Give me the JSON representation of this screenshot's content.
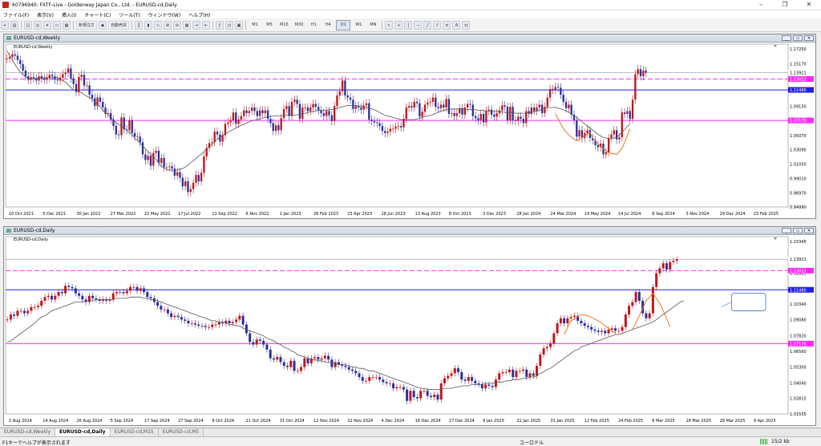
{
  "titlebar": {
    "title": "60796940: FXTF-Live - Goldenway Japan Co., Ltd. - EURUSD-cd,Daily"
  },
  "menu": [
    "ファイル(F)",
    "表示(V)",
    "挿入(I)",
    "チャート(C)",
    "ツール(T)",
    "ウィンドウ(W)",
    "ヘルプ(H)"
  ],
  "toolbar": {
    "new_order": "新規注文",
    "auto_trade": "自動売買",
    "periods": [
      "M1",
      "M5",
      "M15",
      "M30",
      "H1",
      "H4",
      "D1",
      "W1",
      "MN"
    ],
    "active_period": "D1"
  },
  "colors": {
    "bull": "#c0151b",
    "bear": "#2b2f9c",
    "pink": "#ff2aff",
    "blue": "#2020e0",
    "ma": "#555555",
    "orange": "#e87a1e",
    "price_bg": "#2020e0"
  },
  "weekly": {
    "title": "EURUSD-cd,Weekly",
    "y_labels": [
      "1.17250",
      "1.15170",
      "1.13921",
      "1.13011",
      "1.11480",
      "1.09150",
      "1.07175",
      "1.05070",
      "1.03090",
      "1.01050",
      "0.99010",
      "0.96970",
      "0.94990"
    ],
    "x_labels": [
      "10 Oct 2021",
      "5 Dec 2021",
      "30 Jan 2022",
      "27 Mar 2022",
      "22 May 2022",
      "17 Jul 2022",
      "11 Sep 2022",
      "6 Nov 2022",
      "1 Jan 2023",
      "26 Feb 2023",
      "23 Apr 2023",
      "18 Jun 2023",
      "13 Aug 2023",
      "8 Oct 2023",
      "3 Dec 2023",
      "28 Jan 2024",
      "24 Mar 2024",
      "19 May 2024",
      "14 Jul 2024",
      "8 Sep 2024",
      "3 Nov 2024",
      "29 Dec 2024",
      "23 Feb 2025"
    ],
    "ymin": 0.9499,
    "ymax": 1.1725,
    "price": 1.13921,
    "pink": 1.13011,
    "blue": 1.1148,
    "mag": 1.07175,
    "price_label": "1.13921",
    "pink_label": "1.13011",
    "blue_label": "1.11480",
    "mag_label": "1.07175",
    "closes": [
      1.159,
      1.161,
      1.165,
      1.163,
      1.157,
      1.151,
      1.142,
      1.134,
      1.129,
      1.133,
      1.131,
      1.128,
      1.134,
      1.131,
      1.129,
      1.132,
      1.136,
      1.134,
      1.129,
      1.128,
      1.132,
      1.137,
      1.139,
      1.145,
      1.131,
      1.123,
      1.112,
      1.133,
      1.136,
      1.121,
      1.121,
      1.108,
      1.103,
      1.092,
      1.104,
      1.098,
      1.09,
      1.081,
      1.082,
      1.073,
      1.064,
      1.052,
      1.051,
      1.076,
      1.059,
      1.058,
      1.072,
      1.054,
      1.049,
      1.049,
      1.041,
      1.024,
      1.016,
      1.022,
      1.008,
      1.026,
      1.029,
      1.012,
      1.019,
      1.006,
      1.006,
      1.007,
      1.004,
      0.994,
      0.999,
      0.991,
      0.979,
      0.986,
      0.971,
      0.975,
      0.984,
      0.995,
      0.986,
      0.998,
      1.021,
      1.033,
      1.04,
      1.041,
      1.056,
      1.052,
      1.042,
      1.051,
      1.067,
      1.069,
      1.072,
      1.083,
      1.067,
      1.073,
      1.078,
      1.086,
      1.082,
      1.085,
      1.09,
      1.085,
      1.078,
      1.086,
      1.082,
      1.086,
      1.074,
      1.068,
      1.057,
      1.065,
      1.058,
      1.075,
      1.088,
      1.092,
      1.078,
      1.098,
      1.101,
      1.095,
      1.074,
      1.09,
      1.09,
      1.085,
      1.09,
      1.095,
      1.091,
      1.086,
      1.082,
      1.078,
      1.085,
      1.079,
      1.071,
      1.092,
      1.107,
      1.113,
      1.128,
      1.107,
      1.104,
      1.101,
      1.088,
      1.092,
      1.09,
      1.087,
      1.093,
      1.096,
      1.073,
      1.071,
      1.069,
      1.068,
      1.064,
      1.057,
      1.054,
      1.056,
      1.06,
      1.06,
      1.063,
      1.064,
      1.062,
      1.074,
      1.09,
      1.092,
      1.09,
      1.098,
      1.096,
      1.077,
      1.084,
      1.094,
      1.097,
      1.098,
      1.104,
      1.091,
      1.089,
      1.094,
      1.09,
      1.102,
      1.081,
      1.082,
      1.078,
      1.082,
      1.089,
      1.08,
      1.09,
      1.095,
      1.094,
      1.078,
      1.075,
      1.072,
      1.081,
      1.069,
      1.085,
      1.087,
      1.08,
      1.077,
      1.082,
      1.086,
      1.093,
      1.091,
      1.072,
      1.091,
      1.072,
      1.071,
      1.077,
      1.074,
      1.068,
      1.085,
      1.081,
      1.09,
      1.085,
      1.09,
      1.094,
      1.082,
      1.091,
      1.104,
      1.116,
      1.115,
      1.119,
      1.118,
      1.108,
      1.098,
      1.089,
      1.094,
      1.08,
      1.072,
      1.049,
      1.058,
      1.047,
      1.054,
      1.058,
      1.047,
      1.044,
      1.037,
      1.034,
      1.039,
      1.024,
      1.027,
      1.047,
      1.052,
      1.058,
      1.045,
      1.048,
      1.083,
      1.081,
      1.085,
      1.074,
      1.101,
      1.137,
      1.144,
      1.134,
      1.142,
      1.139
    ],
    "ma": [
      1.17,
      1.163,
      1.157,
      1.151,
      1.145,
      1.14,
      1.136,
      1.133,
      1.131,
      1.13,
      1.13,
      1.131,
      1.131,
      1.131,
      1.132,
      1.132,
      1.132,
      1.132,
      1.132,
      1.132,
      1.13,
      1.128,
      1.126,
      1.122,
      1.118,
      1.115,
      1.113,
      1.112,
      1.111,
      1.108,
      1.106,
      1.104,
      1.102,
      1.098,
      1.094,
      1.091,
      1.086,
      1.083,
      1.08,
      1.076,
      1.072,
      1.069,
      1.066,
      1.064,
      1.061,
      1.058,
      1.055,
      1.052,
      1.047,
      1.044,
      1.04,
      1.036,
      1.032,
      1.028,
      1.024,
      1.021,
      1.017,
      1.012,
      1.007,
      1.005,
      1.003,
      1.002,
      1.002,
      1.001,
      1.002,
      1.003,
      1.004,
      1.006,
      1.009,
      1.012,
      1.015,
      1.018,
      1.022,
      1.024,
      1.028,
      1.032,
      1.035,
      1.038,
      1.042,
      1.045,
      1.048,
      1.051,
      1.053,
      1.055,
      1.057,
      1.059,
      1.061,
      1.063,
      1.065,
      1.066,
      1.068,
      1.07,
      1.071,
      1.072,
      1.073,
      1.074,
      1.075,
      1.076,
      1.077,
      1.077,
      1.078,
      1.078,
      1.078,
      1.078,
      1.079,
      1.079,
      1.079,
      1.079,
      1.079,
      1.08,
      1.08,
      1.081,
      1.082,
      1.083,
      1.084,
      1.084,
      1.085,
      1.086,
      1.086,
      1.086,
      1.086,
      1.087,
      1.087,
      1.088,
      1.089,
      1.09,
      1.091,
      1.092,
      1.093,
      1.093,
      1.093,
      1.093,
      1.092,
      1.092,
      1.091,
      1.09,
      1.089,
      1.088,
      1.087,
      1.085,
      1.083,
      1.081,
      1.079,
      1.078,
      1.077,
      1.076,
      1.075,
      1.074,
      1.073,
      1.073,
      1.073,
      1.073,
      1.073,
      1.073,
      1.074,
      1.075,
      1.076,
      1.077,
      1.078,
      1.079,
      1.08,
      1.082,
      1.083,
      1.085,
      1.086,
      1.087,
      1.087,
      1.088,
      1.088,
      1.088,
      1.088,
      1.088,
      1.088,
      1.087,
      1.087,
      1.087,
      1.087,
      1.086,
      1.086,
      1.086,
      1.085,
      1.085,
      1.085,
      1.085,
      1.085,
      1.084,
      1.084,
      1.083,
      1.083,
      1.083,
      1.083,
      1.082,
      1.082,
      1.082,
      1.082,
      1.082,
      1.083,
      1.083,
      1.084,
      1.085,
      1.086,
      1.088,
      1.089,
      1.09,
      1.09,
      1.09,
      1.09,
      1.089,
      1.088,
      1.087,
      1.085,
      1.083,
      1.081,
      1.078,
      1.076,
      1.073,
      1.07,
      1.067,
      1.064,
      1.061,
      1.058,
      1.055,
      1.052,
      1.05,
      1.048,
      1.047,
      1.046,
      1.046,
      1.047,
      1.048,
      1.051,
      1.055,
      1.059,
      1.063,
      1.067
    ]
  },
  "daily": {
    "title": "EURUSD-cd,Daily",
    "y_labels": [
      "1.15345",
      "1.13921",
      "1.12825",
      "1.13011",
      "1.11480",
      "1.10340",
      "1.09080",
      "1.07820",
      "1.07175",
      "1.06560",
      "1.05300",
      "1.04040",
      "1.02815",
      "1.01555"
    ],
    "x_labels": [
      "2 Aug 2024",
      "14 Aug 2024",
      "26 Aug 2024",
      "5 Sep 2024",
      "17 Sep 2024",
      "27 Sep 2024",
      "9 Oct 2024",
      "21 Oct 2024",
      "31 Oct 2024",
      "12 Nov 2024",
      "22 Nov 2024",
      "4 Dec 2024",
      "16 Dec 2024",
      "27 Dec 2024",
      "9 Jan 2025",
      "21 Jan 2025",
      "31 Jan 2025",
      "12 Feb 2025",
      "24 Feb 2025",
      "6 Mar 2025",
      "18 Mar 2025",
      "28 Mar 2025",
      "9 Apr 2025"
    ],
    "ymin": 1.01555,
    "ymax": 1.15345,
    "price": 1.13921,
    "pink": 1.13011,
    "blue": 1.1148,
    "mag": 1.07175,
    "price_label": "1.13921",
    "pink_label": "1.13011",
    "blue_label": "1.11480",
    "mag_label": "1.07175",
    "closes": [
      1.091,
      1.095,
      1.094,
      1.098,
      1.098,
      1.096,
      1.098,
      1.101,
      1.101,
      1.102,
      1.106,
      1.109,
      1.11,
      1.107,
      1.11,
      1.113,
      1.112,
      1.118,
      1.117,
      1.116,
      1.112,
      1.11,
      1.107,
      1.105,
      1.11,
      1.108,
      1.107,
      1.106,
      1.107,
      1.106,
      1.107,
      1.112,
      1.113,
      1.113,
      1.112,
      1.114,
      1.117,
      1.117,
      1.114,
      1.116,
      1.113,
      1.109,
      1.108,
      1.105,
      1.102,
      1.099,
      1.099,
      1.096,
      1.093,
      1.094,
      1.093,
      1.091,
      1.09,
      1.088,
      1.088,
      1.087,
      1.086,
      1.086,
      1.085,
      1.085,
      1.087,
      1.087,
      1.089,
      1.088,
      1.09,
      1.088,
      1.089,
      1.091,
      1.094,
      1.087,
      1.08,
      1.073,
      1.071,
      1.075,
      1.074,
      1.071,
      1.067,
      1.06,
      1.059,
      1.061,
      1.057,
      1.054,
      1.053,
      1.058,
      1.05,
      1.05,
      1.053,
      1.06,
      1.056,
      1.06,
      1.061,
      1.059,
      1.06,
      1.062,
      1.059,
      1.053,
      1.057,
      1.055,
      1.054,
      1.053,
      1.051,
      1.05,
      1.048,
      1.045,
      1.042,
      1.042,
      1.045,
      1.045,
      1.045,
      1.043,
      1.041,
      1.04,
      1.04,
      1.036,
      1.037,
      1.037,
      1.035,
      1.026,
      1.034,
      1.029,
      1.028,
      1.034,
      1.034,
      1.03,
      1.029,
      1.031,
      1.027,
      1.04,
      1.044,
      1.046,
      1.048,
      1.052,
      1.049,
      1.043,
      1.042,
      1.045,
      1.042,
      1.04,
      1.039,
      1.036,
      1.039,
      1.038,
      1.037,
      1.043,
      1.048,
      1.049,
      1.049,
      1.051,
      1.045,
      1.05,
      1.05,
      1.051,
      1.045,
      1.048,
      1.046,
      1.054,
      1.063,
      1.068,
      1.069,
      1.072,
      1.08,
      1.088,
      1.092,
      1.088,
      1.092,
      1.093,
      1.094,
      1.09,
      1.088,
      1.086,
      1.085,
      1.083,
      1.082,
      1.081,
      1.082,
      1.08,
      1.083,
      1.084,
      1.082,
      1.082,
      1.085,
      1.095,
      1.102,
      1.105,
      1.113,
      1.106,
      1.096,
      1.092,
      1.096,
      1.117,
      1.128,
      1.132,
      1.136,
      1.131,
      1.137,
      1.138,
      1.139
    ],
    "ma": [
      1.073,
      1.074,
      1.076,
      1.078,
      1.08,
      1.082,
      1.084,
      1.086,
      1.088,
      1.091,
      1.093,
      1.094,
      1.096,
      1.098,
      1.099,
      1.1,
      1.101,
      1.102,
      1.103,
      1.104,
      1.105,
      1.105,
      1.105,
      1.106,
      1.106,
      1.106,
      1.107,
      1.107,
      1.107,
      1.107,
      1.107,
      1.107,
      1.108,
      1.108,
      1.108,
      1.108,
      1.109,
      1.109,
      1.109,
      1.109,
      1.108,
      1.108,
      1.107,
      1.107,
      1.106,
      1.105,
      1.104,
      1.103,
      1.102,
      1.101,
      1.1,
      1.099,
      1.098,
      1.097,
      1.096,
      1.095,
      1.094,
      1.093,
      1.092,
      1.091,
      1.09,
      1.09,
      1.089,
      1.089,
      1.088,
      1.087,
      1.087,
      1.086,
      1.086,
      1.084,
      1.083,
      1.082,
      1.081,
      1.08,
      1.079,
      1.078,
      1.076,
      1.075,
      1.074,
      1.072,
      1.071,
      1.069,
      1.068,
      1.066,
      1.065,
      1.063,
      1.062,
      1.061,
      1.06,
      1.059,
      1.059,
      1.058,
      1.058,
      1.057,
      1.057,
      1.056,
      1.056,
      1.055,
      1.055,
      1.055,
      1.054,
      1.053,
      1.053,
      1.052,
      1.052,
      1.051,
      1.05,
      1.05,
      1.049,
      1.048,
      1.047,
      1.046,
      1.045,
      1.044,
      1.043,
      1.042,
      1.041,
      1.04,
      1.039,
      1.038,
      1.037,
      1.036,
      1.036,
      1.035,
      1.035,
      1.035,
      1.035,
      1.035,
      1.036,
      1.036,
      1.036,
      1.037,
      1.037,
      1.038,
      1.038,
      1.038,
      1.039,
      1.039,
      1.039,
      1.039,
      1.04,
      1.04,
      1.04,
      1.041,
      1.041,
      1.041,
      1.042,
      1.042,
      1.043,
      1.043,
      1.043,
      1.044,
      1.044,
      1.045,
      1.045,
      1.046,
      1.048,
      1.049,
      1.051,
      1.052,
      1.054,
      1.056,
      1.058,
      1.06,
      1.062,
      1.064,
      1.066,
      1.067,
      1.069,
      1.07,
      1.071,
      1.072,
      1.073,
      1.074,
      1.075,
      1.076,
      1.077,
      1.078,
      1.079,
      1.079,
      1.08,
      1.081,
      1.082,
      1.083,
      1.084,
      1.085,
      1.086,
      1.087,
      1.088,
      1.089,
      1.091,
      1.093,
      1.095,
      1.097,
      1.099,
      1.101,
      1.103,
      1.105,
      1.106
    ]
  },
  "tabs": [
    "EURUSD-cd,Weekly",
    "EURUSD-cd,Daily",
    "EURUSD-cd,M15",
    "EURUSD-cd,M5"
  ],
  "active_tab": "EURUSD-cd,Daily",
  "status": {
    "help": "F1キーでヘルプが表示されます",
    "profile": "ユーロドル",
    "speed": "15/2 kb"
  }
}
